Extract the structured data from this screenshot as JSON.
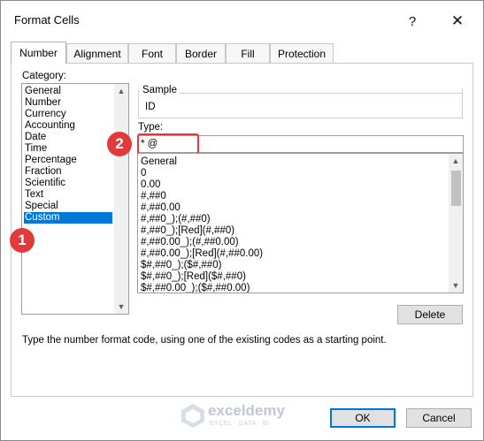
{
  "window": {
    "title": "Format Cells",
    "help_glyph": "?",
    "close_glyph": "✕"
  },
  "tabs": [
    "Number",
    "Alignment",
    "Font",
    "Border",
    "Fill",
    "Protection"
  ],
  "active_tab": "Number",
  "category": {
    "label": "Category:",
    "items": [
      "General",
      "Number",
      "Currency",
      "Accounting",
      "Date",
      "Time",
      "Percentage",
      "Fraction",
      "Scientific",
      "Text",
      "Special",
      "Custom"
    ],
    "selected": "Custom"
  },
  "sample": {
    "label": "Sample",
    "value": "ID"
  },
  "type": {
    "label": "Type:",
    "value": "* @",
    "list": [
      "General",
      "0",
      "0.00",
      "#,##0",
      "#,##0.00",
      "#,##0_);(#,##0)",
      "#,##0_);[Red](#,##0)",
      "#,##0.00_);(#,##0.00)",
      "#,##0.00_);[Red](#,##0.00)",
      "$#,##0_);($#,##0)",
      "$#,##0_);[Red]($#,##0)",
      "$#,##0.00_);($#,##0.00)"
    ]
  },
  "buttons": {
    "delete": "Delete",
    "ok": "OK",
    "cancel": "Cancel"
  },
  "description": "Type the number format code, using one of the existing codes as a starting point.",
  "markers": [
    "1",
    "2"
  ],
  "watermark": {
    "name": "exceldemy",
    "tagline": "EXCEL · DATA · BI"
  },
  "colors": {
    "selection": "#0078d7",
    "marker": "#e23a3a",
    "default_button_border": "#0078d7"
  },
  "icons": {
    "scroll_up": "▲",
    "scroll_down": "▼"
  }
}
